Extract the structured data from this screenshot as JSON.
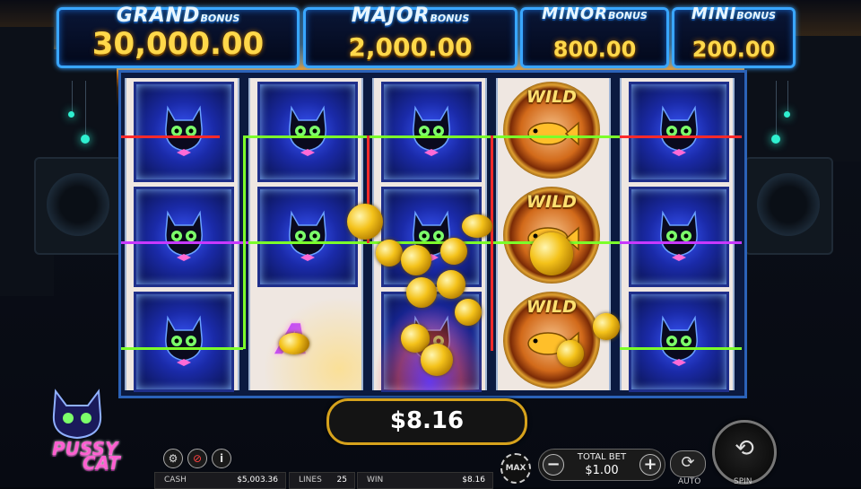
{
  "game": {
    "logo_line1": "PUSSY",
    "logo_line2": "CAT"
  },
  "jackpots": [
    {
      "label_big": "GRAND",
      "label_small": "BONUS",
      "value": "30,000.00"
    },
    {
      "label_big": "MAJOR",
      "label_small": "BONUS",
      "value": "2,000.00"
    },
    {
      "label_big": "MINOR",
      "label_small": "BONUS",
      "value": "800.00"
    },
    {
      "label_big": "MINI",
      "label_small": "BONUS",
      "value": "200.00"
    }
  ],
  "reels": [
    [
      "cat",
      "cat",
      "cat"
    ],
    [
      "cat",
      "cat",
      "A"
    ],
    [
      "cat",
      "cat",
      "cat"
    ],
    [
      "wild",
      "wild",
      "wild"
    ],
    [
      "cat",
      "cat",
      "cat"
    ]
  ],
  "symbols": {
    "wild_text": "WILD",
    "letter_a": "A"
  },
  "win_display": "$8.16",
  "status": {
    "cash_label": "CASH",
    "cash_value": "$5,003.36",
    "lines_label": "LINES",
    "lines_value": "25",
    "win_label": "WIN",
    "win_value": "$8.16"
  },
  "controls": {
    "max_label": "MAX",
    "total_bet_label": "TOTAL BET",
    "total_bet_value": "$1.00",
    "minus": "−",
    "plus": "+",
    "auto_label": "AUTO",
    "spin_label": "SPIN",
    "settings_icon": "⚙",
    "sound_icon": "🔇",
    "info_icon": "i"
  },
  "colors": {
    "payline_red": "#ff2a2a",
    "payline_green": "#7cff2a",
    "payline_purple": "#c838ff",
    "gold": "#ffd84a",
    "frame_blue": "#2b62b8"
  }
}
